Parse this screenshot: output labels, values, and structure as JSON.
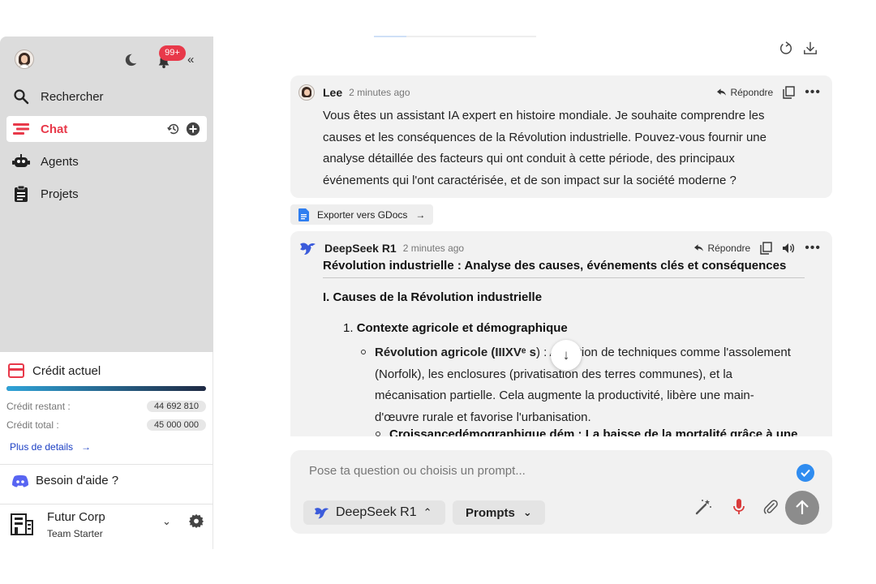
{
  "sidebar": {
    "notifications_badge": "99+",
    "nav": [
      {
        "label": "Rechercher",
        "icon": "search-icon"
      },
      {
        "label": "Chat",
        "icon": "chat-icon",
        "active": true
      },
      {
        "label": "Agents",
        "icon": "robot-icon"
      },
      {
        "label": "Projets",
        "icon": "clipboard-icon"
      }
    ],
    "credit": {
      "title": "Crédit actuel",
      "remaining_label": "Crédit restant :",
      "remaining_value": "44 692 810",
      "total_label": "Crédit total :",
      "total_value": "45 000 000",
      "remaining_fraction": 0.9932,
      "more_label": "Plus de details"
    },
    "help_label": "Besoin d'aide ?",
    "org": {
      "name": "Futur Corp",
      "plan": "Team Starter"
    }
  },
  "messages": {
    "user": {
      "author": "Lee",
      "time": "2 minutes ago",
      "reply_label": "Répondre",
      "text": "Vous êtes un assistant IA expert en histoire mondiale. Je souhaite comprendre les causes et les conséquences de la Révolution industrielle. Pouvez-vous fournir une analyse détaillée des facteurs qui ont conduit à cette période, des principaux événements qui l'ont caractérisée, et de son impact sur la société moderne ?"
    },
    "export_label": "Exporter vers GDocs",
    "ai": {
      "author": "DeepSeek R1",
      "time": "2 minutes ago",
      "reply_label": "Répondre",
      "title": "Révolution industrielle : Analyse des causes, événements clés et conséquences",
      "section": "I. Causes de la Révolution industrielle",
      "item_number": "1.",
      "item_title": "Contexte agricole et démographique",
      "sub1_bold": "Révolution agricole (IIIXVᵉ s",
      "sub1_text": ") : Adoption de techniques comme l'assolement (Norfolk), les enclosures (privatisation des terres communes), et la mécanisation partielle. Cela augmente la productivité, libère une main-d'œuvre rurale et favorise l'urbanisation.",
      "sub2_partial": "Croissancedémographique dém : La baisse de la mortalité grâce à une"
    }
  },
  "composer": {
    "placeholder": "Pose ta question ou choisis un prompt...",
    "model_label": "DeepSeek R1",
    "prompts_label": "Prompts"
  },
  "colors": {
    "accent": "#e8394a",
    "link": "#1b3fc4",
    "check": "#2f8cf0"
  }
}
